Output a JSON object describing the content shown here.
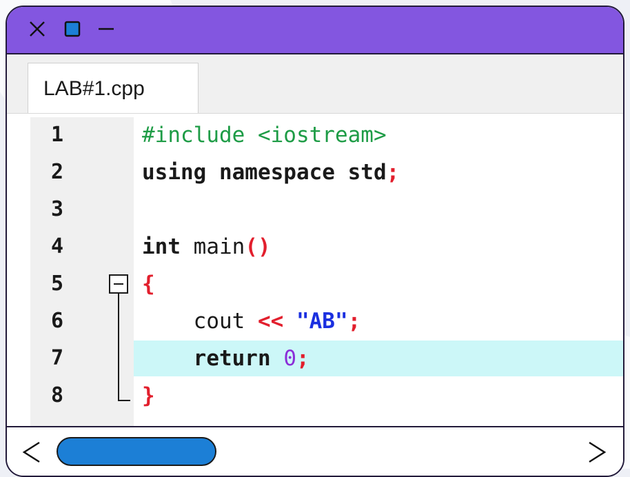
{
  "window": {
    "controls": [
      {
        "name": "close",
        "icon": "close-icon"
      },
      {
        "name": "restore",
        "icon": "restore-icon"
      },
      {
        "name": "minimize",
        "icon": "minimize-icon"
      }
    ],
    "accent_color": "#8356e0"
  },
  "tabs": [
    {
      "label": "LAB#1.cpp",
      "active": true
    }
  ],
  "editor": {
    "line_numbers": [
      "1",
      "2",
      "3",
      "4",
      "5",
      "6",
      "7",
      "8"
    ],
    "highlighted_line": 7,
    "lines": [
      {
        "parts": [
          {
            "text": "#include <iostream>",
            "cls": "pp"
          }
        ]
      },
      {
        "parts": [
          {
            "text": "using namespace std",
            "cls": "kw"
          },
          {
            "text": ";",
            "cls": "sym"
          }
        ]
      },
      {
        "parts": []
      },
      {
        "parts": [
          {
            "text": "int ",
            "cls": "kw"
          },
          {
            "text": "main",
            "cls": "plain"
          },
          {
            "text": "()",
            "cls": "sym"
          }
        ]
      },
      {
        "parts": [
          {
            "text": "{",
            "cls": "sym"
          }
        ]
      },
      {
        "parts": [
          {
            "text": "    cout ",
            "cls": "plain"
          },
          {
            "text": "<<",
            "cls": "sym"
          },
          {
            "text": " ",
            "cls": "plain"
          },
          {
            "text": "\"AB\"",
            "cls": "str"
          },
          {
            "text": ";",
            "cls": "sym"
          }
        ]
      },
      {
        "parts": [
          {
            "text": "    return ",
            "cls": "kw"
          },
          {
            "text": "0",
            "cls": "num"
          },
          {
            "text": ";",
            "cls": "sym"
          }
        ]
      },
      {
        "parts": [
          {
            "text": "}",
            "cls": "sym"
          }
        ]
      }
    ]
  },
  "scrollbar": {
    "left_arrow": "<",
    "right_arrow": ">",
    "thumb_color": "#1c7fd6"
  }
}
